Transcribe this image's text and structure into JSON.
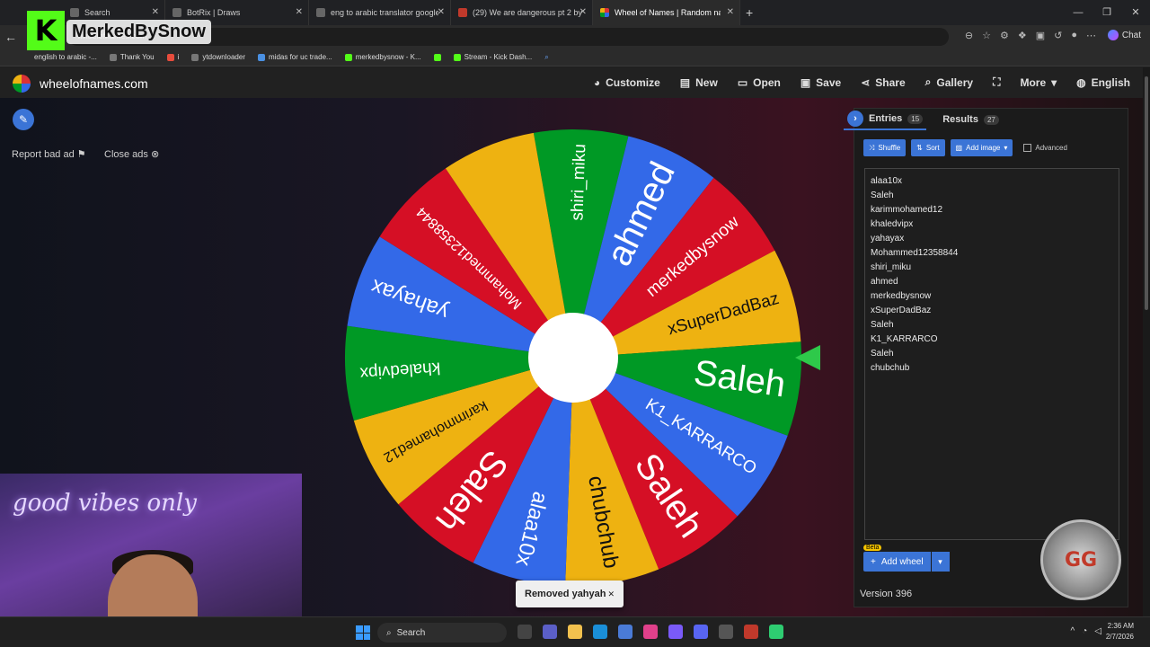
{
  "browser": {
    "tabs": [
      {
        "label": "Search"
      },
      {
        "label": "BotRix | Draws"
      },
      {
        "label": "eng to arabic translator google - S"
      },
      {
        "label": "(29) We are dangerous pt 2 by BO"
      },
      {
        "label": "Wheel of Names | Random na"
      }
    ],
    "address_text": "wheelofnames.com",
    "chat_label": "Chat",
    "bookmarks": [
      {
        "label": "english to arabic -..."
      },
      {
        "label": "Thank You"
      },
      {
        "label": "i"
      },
      {
        "label": "ytdownloader"
      },
      {
        "label": "midas for uc trade..."
      },
      {
        "label": "merkedbysnow - K..."
      },
      {
        "label": "Stream - Kick Dash..."
      }
    ]
  },
  "overlay": {
    "kick_letter": "K",
    "streamer_name": "MerkedBySnow"
  },
  "site": {
    "name": "wheelofnames.com",
    "nav": [
      {
        "label": "Customize",
        "icon": "palette-icon"
      },
      {
        "label": "New",
        "icon": "file-icon"
      },
      {
        "label": "Open",
        "icon": "folder-icon"
      },
      {
        "label": "Save",
        "icon": "save-icon"
      },
      {
        "label": "Share",
        "icon": "share-icon"
      },
      {
        "label": "Gallery",
        "icon": "search-icon"
      },
      {
        "label": "",
        "icon": "fullscreen-icon"
      },
      {
        "label": "More",
        "icon": "chevron-down-icon"
      },
      {
        "label": "English",
        "icon": "globe-icon"
      }
    ],
    "report_label": "Report bad ad",
    "close_ads_label": "Close ads"
  },
  "wheel": {
    "segments": [
      {
        "name": "shiri_miku",
        "color": "#009925"
      },
      {
        "name": "ahmed",
        "color": "#3369e8"
      },
      {
        "name": "merkedbysnow",
        "color": "#d50f25"
      },
      {
        "name": "xSuperDadBaz",
        "color": "#eeb211"
      },
      {
        "name": "Saleh",
        "color": "#009925"
      },
      {
        "name": "K1_KARRARCO",
        "color": "#3369e8"
      },
      {
        "name": "Saleh",
        "color": "#d50f25"
      },
      {
        "name": "chubchub",
        "color": "#eeb211"
      },
      {
        "name": "alaa10x",
        "color": "#3369e8"
      },
      {
        "name": "Saleh",
        "color": "#d50f25"
      },
      {
        "name": "karimmohamed12",
        "color": "#eeb211"
      },
      {
        "name": "khaledvipx",
        "color": "#009925"
      },
      {
        "name": "yahayax",
        "color": "#3369e8"
      },
      {
        "name": "Mohammed12358844",
        "color": "#d50f25"
      },
      {
        "name": "",
        "color": "#eeb211"
      }
    ]
  },
  "panel": {
    "tabs": [
      {
        "label": "Entries",
        "count": "15"
      },
      {
        "label": "Results",
        "count": "27"
      }
    ],
    "toolbar": {
      "shuffle": "Shuffle",
      "sort": "Sort",
      "add_image": "Add image",
      "advanced": "Advanced"
    },
    "entries": [
      "alaa10x",
      "Saleh",
      "karimmohamed12",
      "khaledvipx",
      "yahayax",
      "Mohammed12358844",
      "shiri_miku",
      "ahmed",
      "merkedbysnow",
      "xSuperDadBaz",
      "Saleh",
      "K1_KARRARCO",
      "Saleh",
      "chubchub"
    ],
    "add_wheel": "Add wheel",
    "beta": "Beta",
    "version": "Version 396"
  },
  "toast": {
    "text": "Removed yahyah"
  },
  "webcam": {
    "neon_text": "good vibes only"
  },
  "taskbar": {
    "search_label": "Search",
    "time": "2:36 AM",
    "date": "2/7/2026"
  },
  "colors": {
    "accent": "#3b74d6",
    "pointer": "#2ec94a"
  }
}
